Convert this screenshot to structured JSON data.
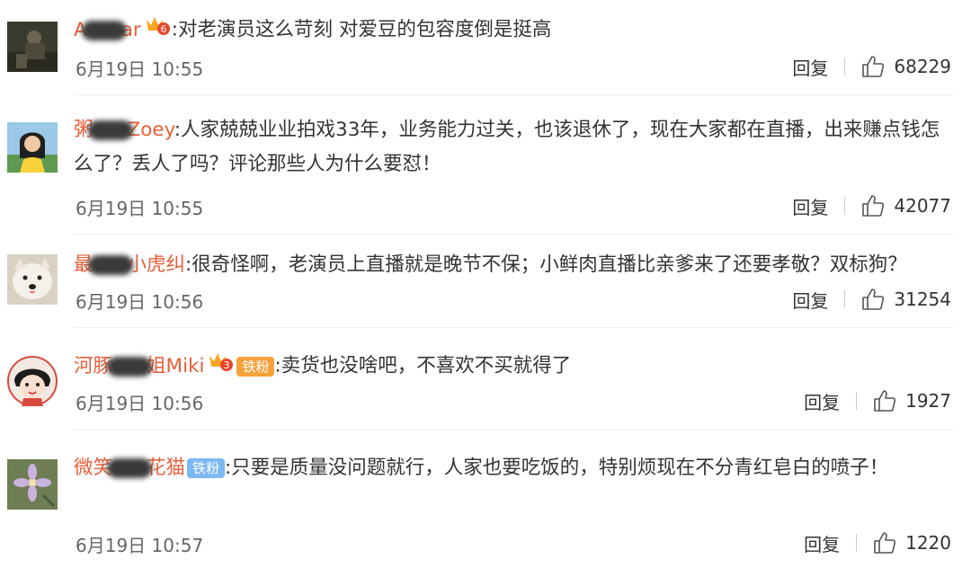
{
  "labels": {
    "reply": "回复"
  },
  "comments": [
    {
      "user": {
        "name_start": "A",
        "name_end": "ar"
      },
      "badges": {
        "vip_level": "6",
        "fan": ""
      },
      "separator": ":",
      "text": "对老演员这么苛刻 对爱豆的包容度倒是挺高",
      "time": "6月19日 10:55",
      "likes": "68229"
    },
    {
      "user": {
        "name_start": "粥",
        "name_end": "Zoey"
      },
      "badges": {
        "vip_level": "",
        "fan": ""
      },
      "separator": ":",
      "text": "人家兢兢业业拍戏33年，业务能力过关，也该退休了，现在大家都在直播，出来赚点钱怎么了？丢人了吗？评论那些人为什么要怼！",
      "time": "6月19日 10:55",
      "likes": "42077"
    },
    {
      "user": {
        "name_start": "最",
        "name_end": "小虎纠"
      },
      "badges": {
        "vip_level": "",
        "fan": ""
      },
      "separator": ":",
      "text": "很奇怪啊，老演员上直播就是晚节不保；小鲜肉直播比亲爹来了还要孝敬？双标狗？",
      "time": "6月19日 10:56",
      "likes": "31254"
    },
    {
      "user": {
        "name_start": "河豚",
        "name_end": "姐Miki"
      },
      "badges": {
        "vip_level": "3",
        "fan": "铁粉"
      },
      "separator": ":",
      "text": "卖货也没啥吧，不喜欢不买就得了",
      "time": "6月19日 10:56",
      "likes": "1927"
    },
    {
      "user": {
        "name_start": "微笑",
        "name_end": "花猫"
      },
      "badges": {
        "vip_level": "",
        "fan": "铁粉"
      },
      "separator": ":",
      "text": "只要是质量没问题就行，人家也要吃饭的，特别烦现在不分青红皂白的喷子！",
      "time": "6月19日 10:57",
      "likes": "1220"
    }
  ],
  "colors": {
    "username": "#e85f39",
    "fan_orange": "#f8a13b",
    "fan_blue": "#7cb8f2"
  },
  "icons": {
    "like": "thumbs-up-icon",
    "vip": "vip-crown-icon"
  }
}
